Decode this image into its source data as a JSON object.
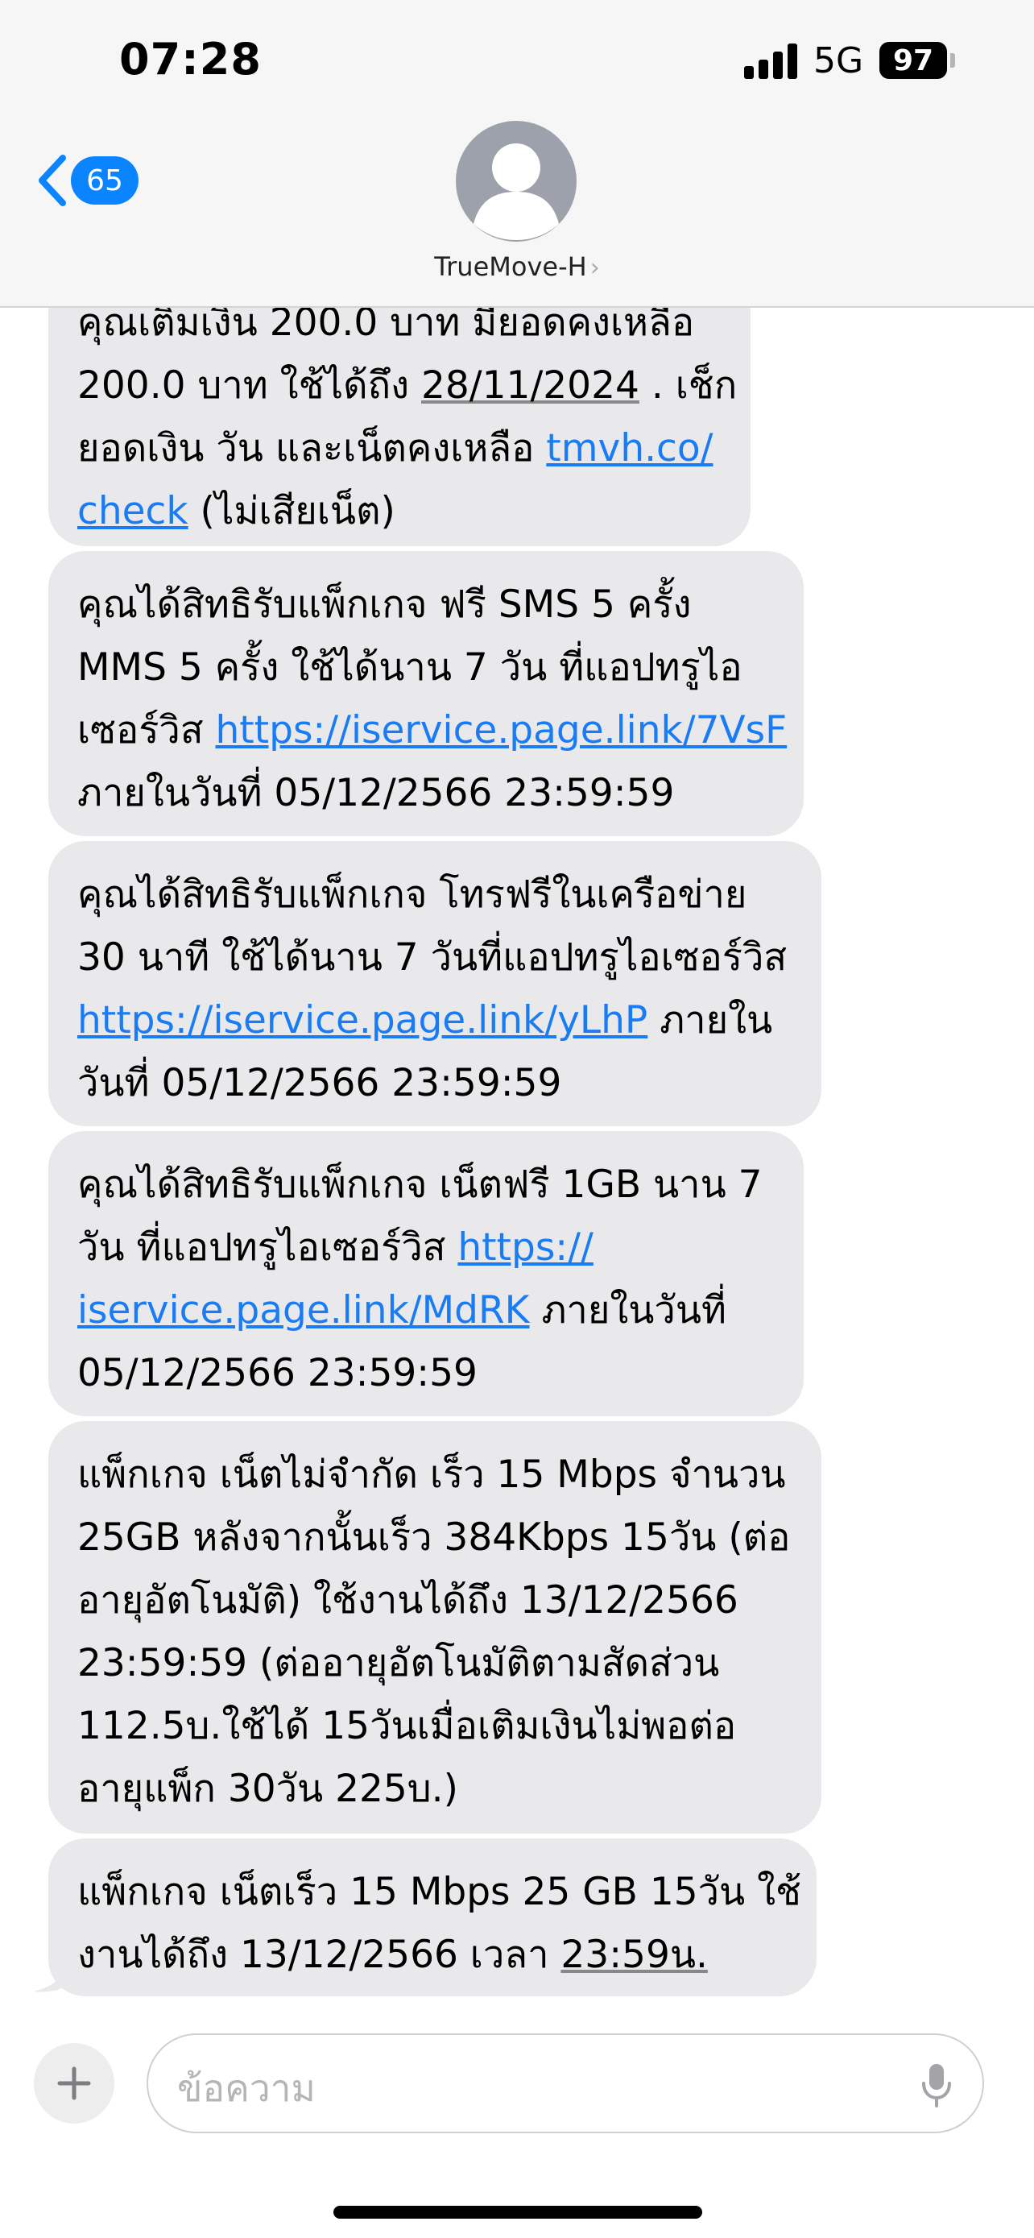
{
  "status_bar": {
    "time": "07:28",
    "network": "5G",
    "battery": "97"
  },
  "nav": {
    "back_count": "65",
    "contact_name": "TrueMove-H"
  },
  "messages": [
    {
      "lines": [
        [
          "คุณเติมเงิน 200.0 บาท มียอดคงเหลือ"
        ],
        [
          "200.0 บาท ใช้ได้ถึง ",
          {
            "u": "28/11/2024"
          },
          " . เช็ก"
        ],
        [
          "ยอดเงิน วัน และเน็ตคงเหลือ ",
          {
            "link": "tmvh.co/"
          }
        ],
        [
          {
            "link": "check"
          },
          " (ไม่เสียเน็ต)"
        ]
      ]
    },
    {
      "lines": [
        [
          "คุณได้สิทธิรับแพ็กเกจ ฟรี SMS 5 ครั้ง"
        ],
        [
          "MMS 5 ครั้ง ใช้ได้นาน 7 วัน ที่แอปทรูไอ"
        ],
        [
          "เซอร์วิส ",
          {
            "link": "https://iservice.page.link/7VsF"
          }
        ],
        [
          "ภายในวันที่ 05/12/2566 23:59:59"
        ]
      ]
    },
    {
      "lines": [
        [
          "คุณได้สิทธิรับแพ็กเกจ โทรฟรีในเครือข่าย"
        ],
        [
          "30 นาที ใช้ได้นาน 7 วันที่แอปทรูไอเซอร์วิส"
        ],
        [
          {
            "link": "https://iservice.page.link/yLhP"
          },
          " ภายใน"
        ],
        [
          "วันที่ 05/12/2566 23:59:59"
        ]
      ]
    },
    {
      "lines": [
        [
          "คุณได้สิทธิรับแพ็กเกจ เน็ตฟรี 1GB นาน 7"
        ],
        [
          "วัน ที่แอปทรูไอเซอร์วิส ",
          {
            "link": "https://"
          }
        ],
        [
          {
            "link": "iservice.page.link/MdRK"
          },
          "  ภายในวันที่"
        ],
        [
          "05/12/2566 23:59:59"
        ]
      ]
    },
    {
      "lines": [
        [
          "แพ็กเกจ เน็ตไม่จำกัด เร็ว 15 Mbps จำนวน"
        ],
        [
          "25GB หลังจากนั้นเร็ว 384Kbps 15วัน (ต่อ"
        ],
        [
          "อายุอัตโนมัติ) ใช้งานได้ถึง 13/12/2566"
        ],
        [
          "23:59:59 (ต่ออายุอัตโนมัติตามสัดส่วน"
        ],
        [
          "112.5บ.ใช้ได้ 15วันเมื่อเติมเงินไม่พอต่อ"
        ],
        [
          "อายุแพ็ก 30วัน 225บ.)"
        ]
      ]
    },
    {
      "lines": [
        [
          "แพ็กเกจ เน็ตเร็ว 15 Mbps 25 GB 15วัน ใช้"
        ],
        [
          "งานได้ถึง 13/12/2566 เวลา ",
          {
            "u": "23:59น."
          }
        ]
      ]
    }
  ],
  "composer": {
    "placeholder": "ข้อความ"
  },
  "colors": {
    "bubble": "#e9e9eb",
    "link": "#1a7cf5",
    "accent": "#0a84ff",
    "header": "#f6f6f6"
  },
  "icons": {
    "back": "chevron-left-icon",
    "avatar": "person-icon",
    "add": "plus-icon",
    "mic": "microphone-icon"
  }
}
